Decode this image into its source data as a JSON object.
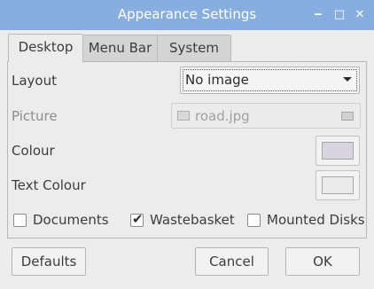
{
  "window": {
    "title": "Appearance Settings",
    "controls": {
      "minimize": "‒",
      "maximize": "□",
      "close": "✕"
    }
  },
  "tabs": [
    {
      "label": "Desktop",
      "active": true
    },
    {
      "label": "Menu Bar",
      "active": false
    },
    {
      "label": "System",
      "active": false
    }
  ],
  "desktop": {
    "layout_label": "Layout",
    "layout_value": "No image",
    "picture_label": "Picture",
    "picture_value": "road.jpg",
    "colour_label": "Colour",
    "colour_value": "#d8d5e0",
    "text_colour_label": "Text Colour",
    "text_colour_value": "#ebebeb",
    "checkboxes": [
      {
        "label": "Documents",
        "checked": false
      },
      {
        "label": "Wastebasket",
        "checked": true
      },
      {
        "label": "Mounted Disks",
        "checked": false
      }
    ]
  },
  "buttons": {
    "defaults": "Defaults",
    "cancel": "Cancel",
    "ok": "OK"
  },
  "colors": {
    "titlebar": "#87aede",
    "window_bg": "#ececec"
  }
}
